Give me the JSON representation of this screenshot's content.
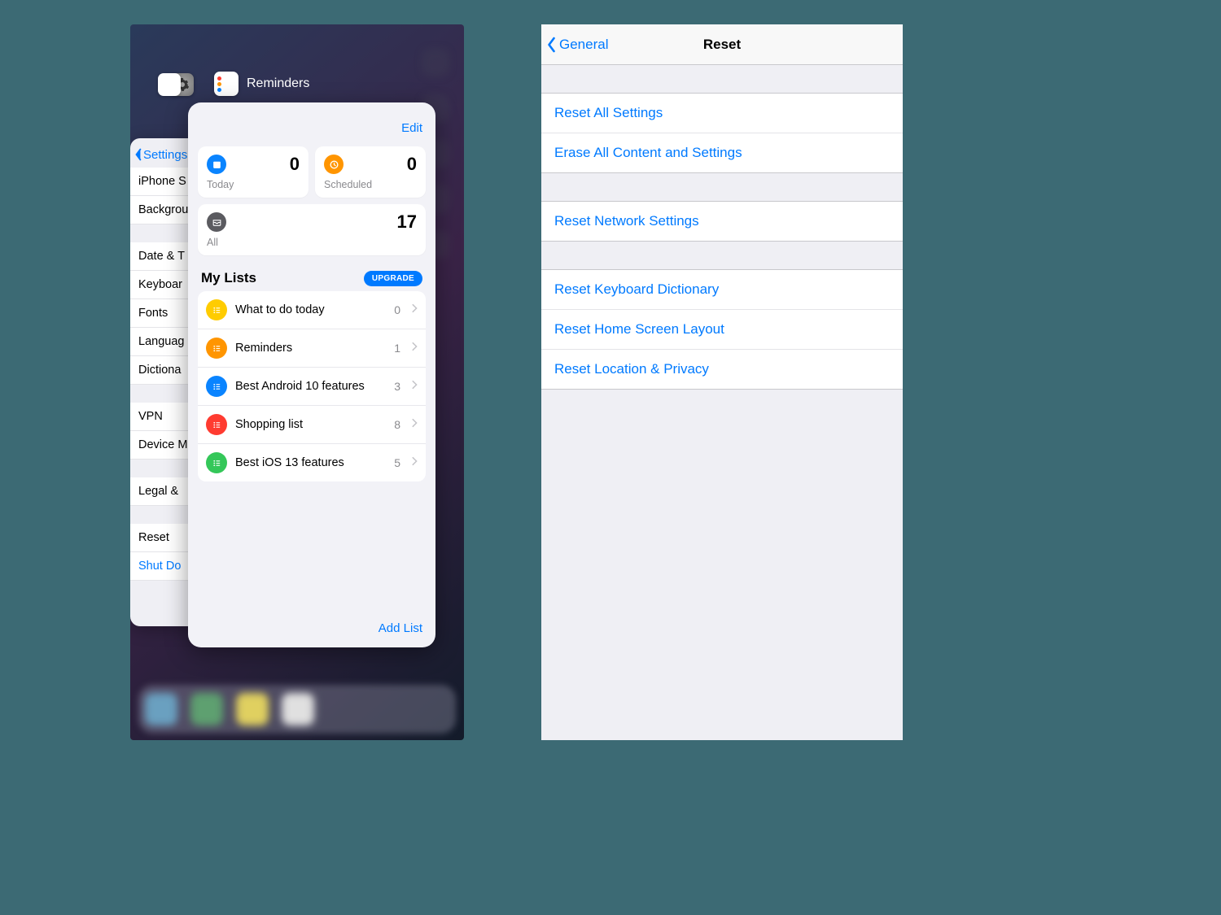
{
  "left": {
    "switcher_apps": {
      "reminders_label": "Reminders"
    },
    "settings_card": {
      "back_label": "Settings",
      "rows_a": [
        "iPhone S",
        "Backgrou"
      ],
      "rows_b": [
        "Date & T",
        "Keyboar",
        "Fonts",
        "Languag",
        "Dictiona"
      ],
      "rows_c": [
        "VPN",
        "Device M"
      ],
      "rows_d": [
        "Legal &"
      ],
      "rows_e": [
        "Reset"
      ],
      "rows_f_blue": "Shut Do"
    },
    "reminders_card": {
      "edit_label": "Edit",
      "smart": {
        "today": {
          "label": "Today",
          "count": "0"
        },
        "scheduled": {
          "label": "Scheduled",
          "count": "0"
        },
        "all": {
          "label": "All",
          "count": "17"
        }
      },
      "mylists_header": "My Lists",
      "upgrade_label": "UPGRADE",
      "lists": [
        {
          "name": "What to do today",
          "count": "0",
          "color": "#ffcc00"
        },
        {
          "name": "Reminders",
          "count": "1",
          "color": "#ff9500"
        },
        {
          "name": "Best Android 10 features",
          "count": "3",
          "color": "#0a84ff"
        },
        {
          "name": "Shopping list",
          "count": "8",
          "color": "#ff3b30"
        },
        {
          "name": "Best iOS 13 features",
          "count": "5",
          "color": "#34c759"
        }
      ],
      "add_list_label": "Add List"
    }
  },
  "right": {
    "back_label": "General",
    "title": "Reset",
    "group1": [
      "Reset All Settings",
      "Erase All Content and Settings"
    ],
    "group2": [
      "Reset Network Settings"
    ],
    "group3": [
      "Reset Keyboard Dictionary",
      "Reset Home Screen Layout",
      "Reset Location & Privacy"
    ]
  }
}
